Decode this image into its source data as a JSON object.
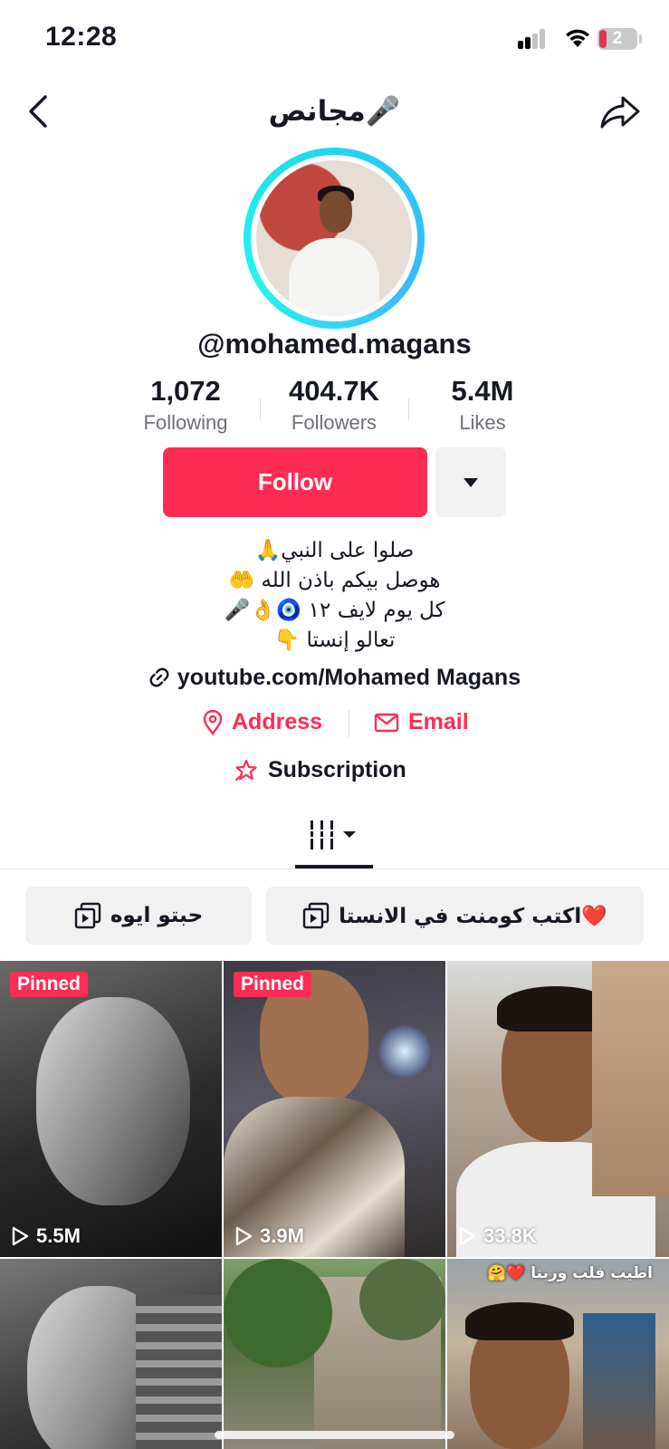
{
  "status_bar": {
    "time": "12:28",
    "battery_level": "2"
  },
  "header": {
    "title": "مجانص🎤",
    "back_icon": "chevron-left-icon",
    "share_icon": "share-arrow-icon"
  },
  "profile": {
    "username": "@mohamed.magans",
    "stats": [
      {
        "value": "1,072",
        "label": "Following"
      },
      {
        "value": "404.7K",
        "label": "Followers"
      },
      {
        "value": "5.4M",
        "label": "Likes"
      }
    ],
    "follow_label": "Follow",
    "bio": [
      "صلوا على النبي🙏",
      "هوصل بيكم باذن الله 🤲",
      "كل يوم لايف ١٢ 🧿👌🎤",
      "تعالو إنستا 👇"
    ],
    "link": "youtube.com/Mohamed Magans",
    "address_label": "Address",
    "email_label": "Email",
    "subscription_label": "Subscription"
  },
  "playlists": [
    {
      "label": "حبتو ايوه"
    },
    {
      "label": "اكتب كومنت في الانستا❤️"
    }
  ],
  "videos": [
    {
      "pinned": "Pinned",
      "views": "5.5M"
    },
    {
      "pinned": "Pinned",
      "views": "3.9M"
    },
    {
      "views": "33.8K"
    },
    {},
    {},
    {
      "caption": "اطيب قلب وربنا ❤️🤗"
    }
  ],
  "colors": {
    "accent": "#fe2c55",
    "ring": "#20d5ec"
  }
}
